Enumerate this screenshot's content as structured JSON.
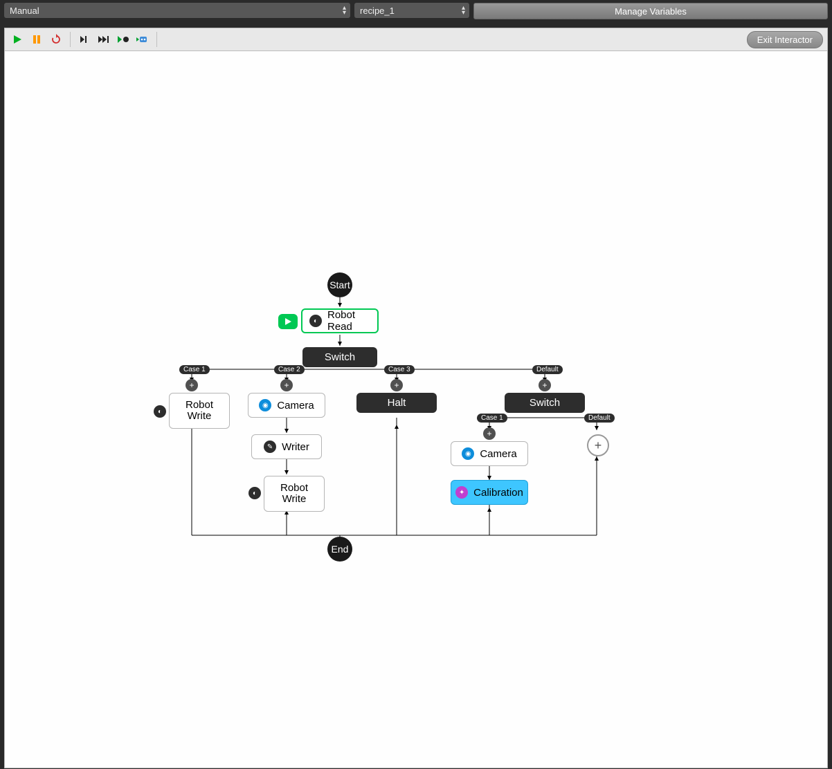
{
  "header": {
    "mode_value": "Manual",
    "recipe_value": "recipe_1",
    "manage_label": "Manage Variables"
  },
  "toolbar": {
    "exit_label": "Exit Interactor"
  },
  "flow": {
    "start": "Start",
    "end": "End",
    "robot_read": "Robot Read",
    "switch1": "Switch",
    "cases": {
      "case1": "Case 1",
      "case2": "Case 2",
      "case3": "Case 3",
      "default": "Default"
    },
    "robot_write1": "Robot Write",
    "camera1": "Camera",
    "writer": "Writer",
    "robot_write2": "Robot Write",
    "halt": "Halt",
    "switch2": "Switch",
    "inner_cases": {
      "case1": "Case 1",
      "default": "Default"
    },
    "camera2": "Camera",
    "calibration": "Calibration"
  }
}
